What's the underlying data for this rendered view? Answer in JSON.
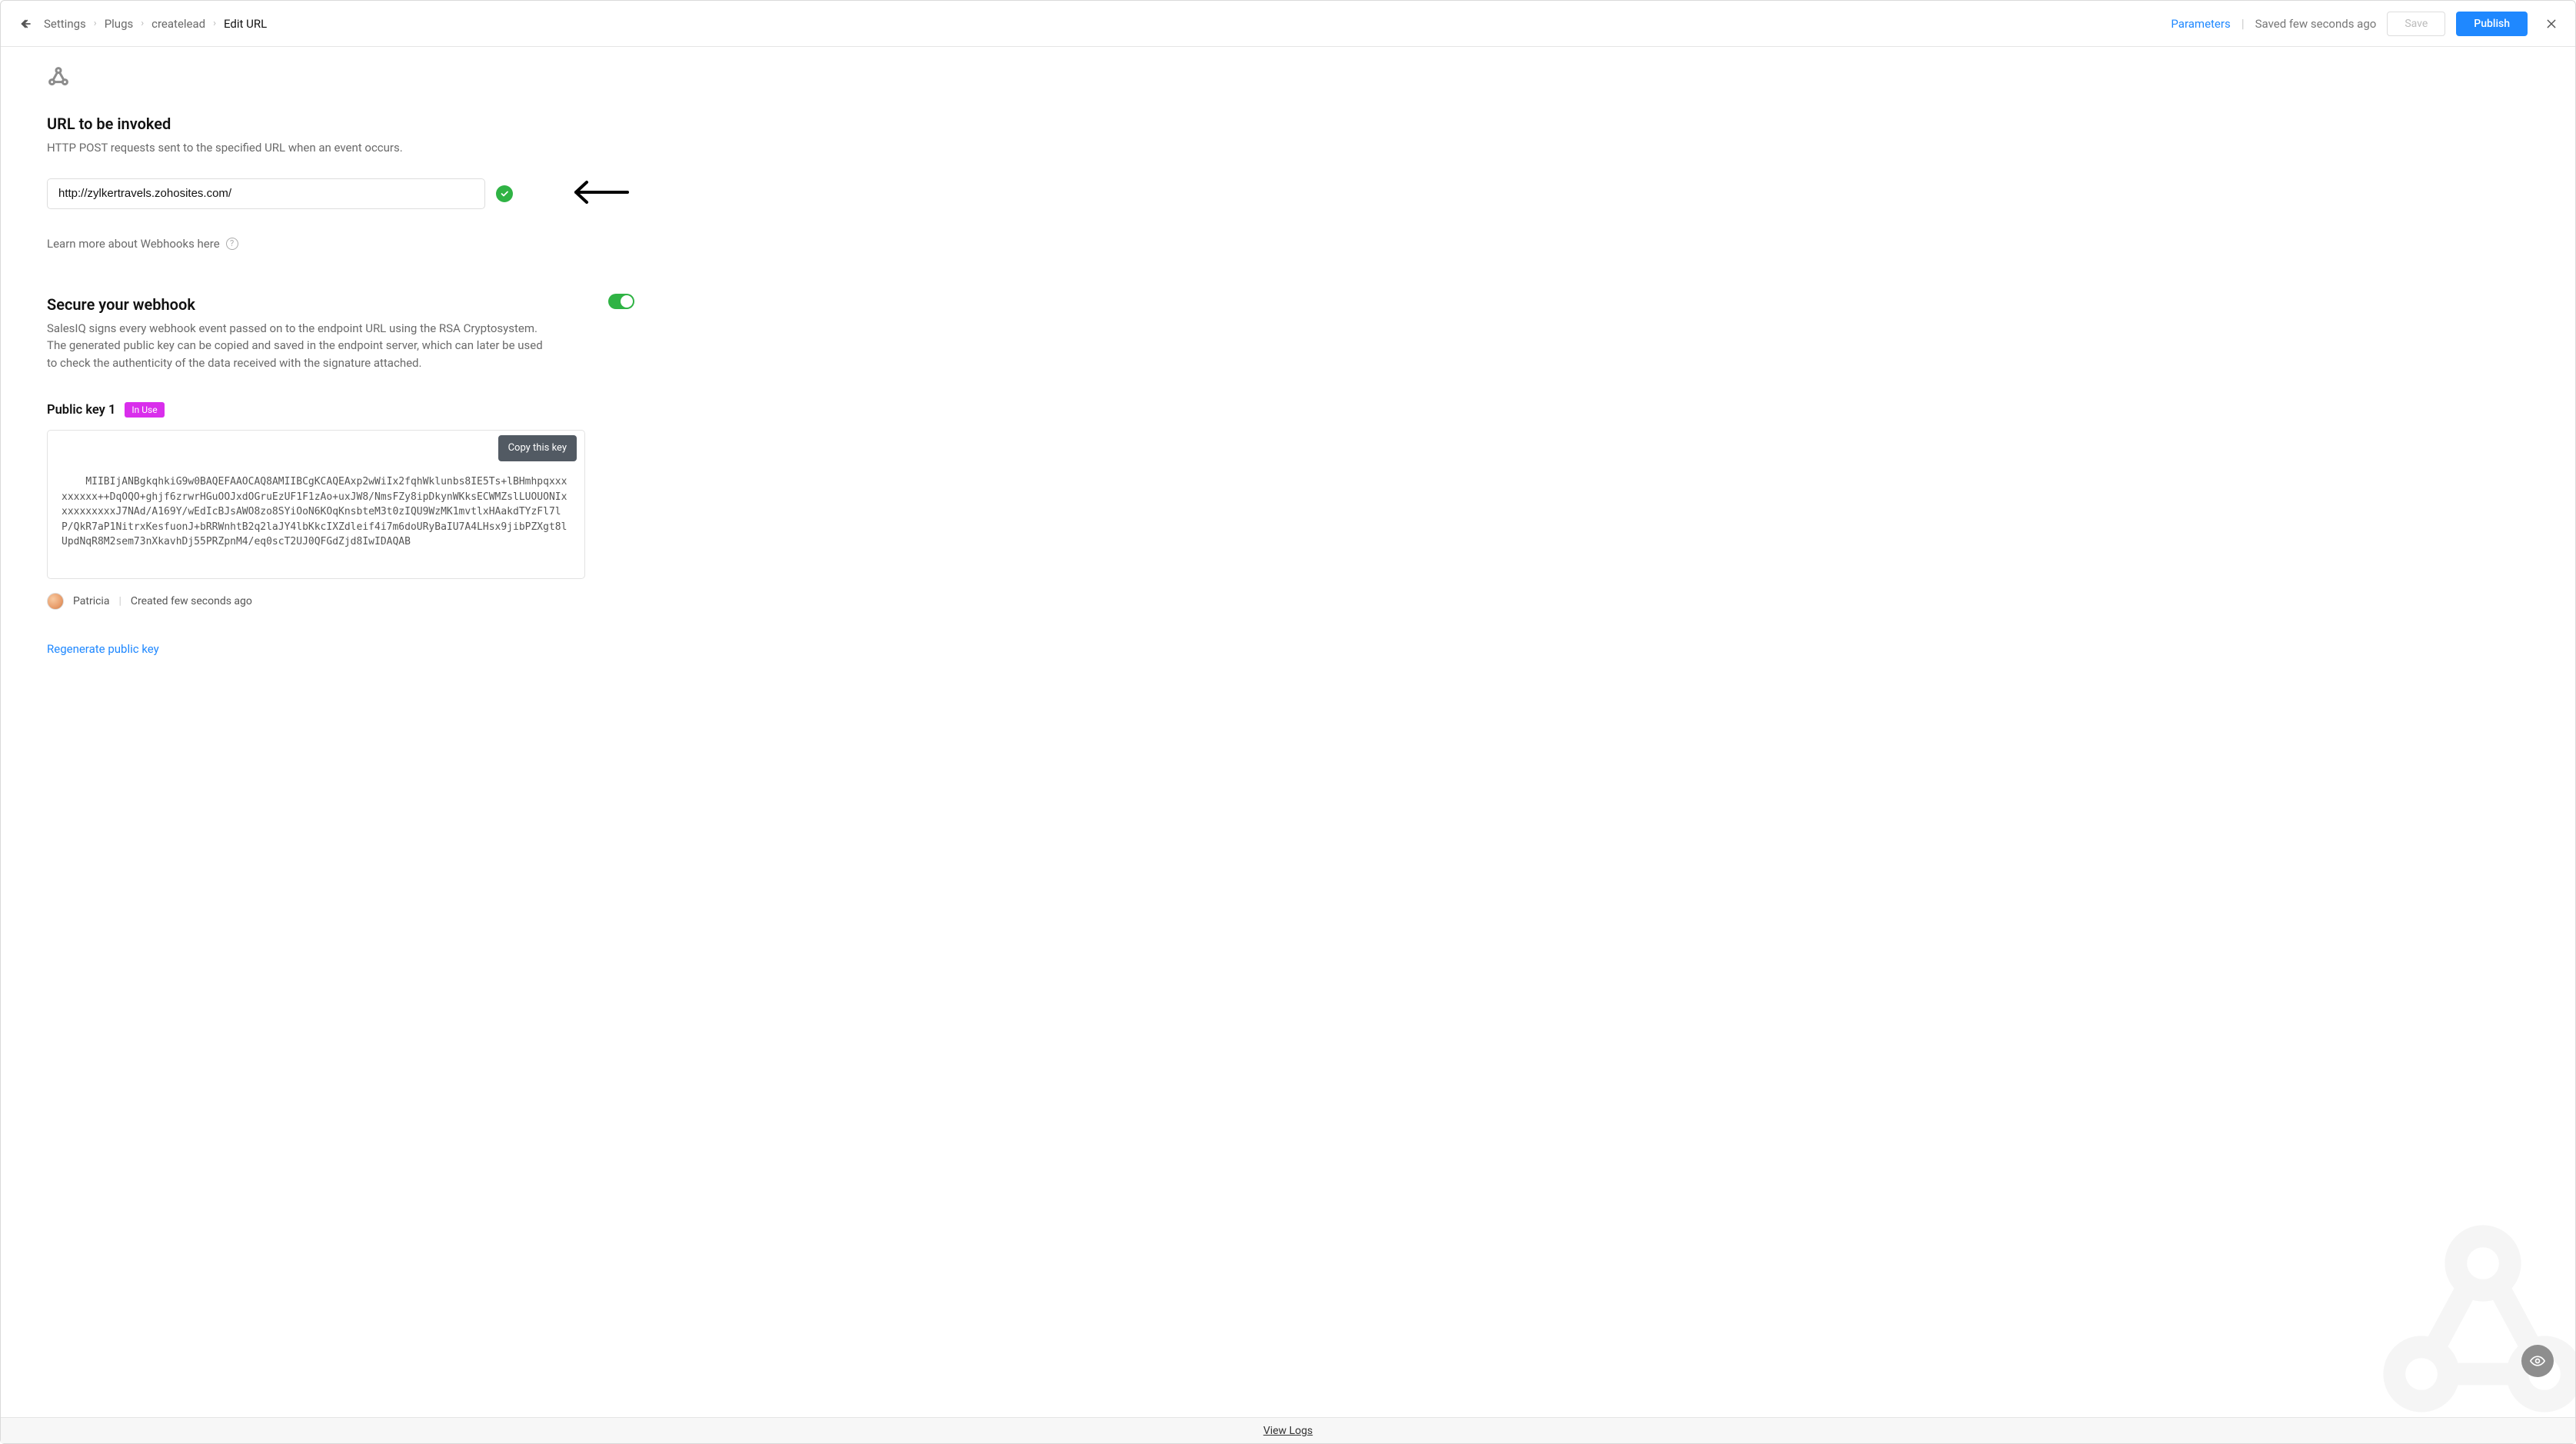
{
  "breadcrumb": {
    "items": [
      "Settings",
      "Plugs",
      "createlead",
      "Edit URL"
    ]
  },
  "header": {
    "parameters": "Parameters",
    "status": "Saved few seconds ago",
    "save": "Save",
    "publish": "Publish"
  },
  "url_section": {
    "title": "URL to be invoked",
    "subtitle": "HTTP POST requests sent to the specified URL when an event occurs.",
    "url_value": "http://zylkertravels.zohosites.com/",
    "learn_more": "Learn more about Webhooks here"
  },
  "secure_section": {
    "title": "Secure your webhook",
    "desc": "SalesIQ signs every webhook event passed on to the endpoint URL using the RSA Cryptosystem. The generated public key can be copied and saved in the endpoint server, which can later be used to check the authenticity of the data received with the signature attached.",
    "enabled": true
  },
  "key_section": {
    "title": "Public key 1",
    "badge": "In Use",
    "copy_label": "Copy this key",
    "key_text": "MIIBIjANBgkqhkiG9w0BAQEFAAOCAQ8AMIIBCgKCAQEAxp2wWiIx2fqhWklunbs8IE5Ts+lBHmhpqxxxxxxxxx++DqOQO+ghjf6zrwrHGuOOJxdOGruEzUF1F1zAo+uxJW8/NmsFZy8ipDkynWKksECWMZslLUOUONIxxxxxxxxxxJ7NAd/A169Y/wEdIcBJsAWO8zo8SYiOoN6KOqKnsbteM3t0zIQU9WzMK1mvtlxHAakdTYzFl7lP/QkR7aP1NitrxKesfuonJ+bRRWnhtB2q2laJY4lbKkcIXZdleif4i7m6doURyBaIU7A4LHsx9jibPZXgt8lUpdNqR8M2sem73nXkavhDj55PRZpnM4/eq0scT2UJ0QFGdZjd8IwIDAQAB",
    "author": "Patricia",
    "created": "Created few seconds ago",
    "regen": "Regenerate public key"
  },
  "footer": {
    "view_logs": "View Logs"
  }
}
